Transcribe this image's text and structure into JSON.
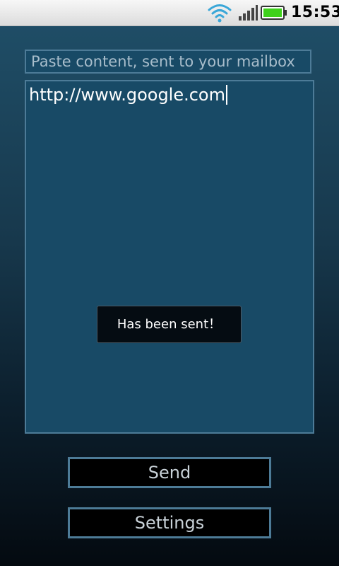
{
  "status_bar": {
    "time": "15:53",
    "icons": [
      "wifi-icon",
      "signal-icon",
      "battery-icon"
    ],
    "battery_color": "#3fd11b"
  },
  "form": {
    "subject_placeholder": "Paste content, sent to your mailbox",
    "content_value": "http://www.google.com"
  },
  "toast": {
    "message": "Has been sent！"
  },
  "buttons": {
    "send_label": "Send",
    "settings_label": "Settings"
  },
  "colors": {
    "accent_border": "#4d7b97",
    "field_background": "#184a66"
  }
}
